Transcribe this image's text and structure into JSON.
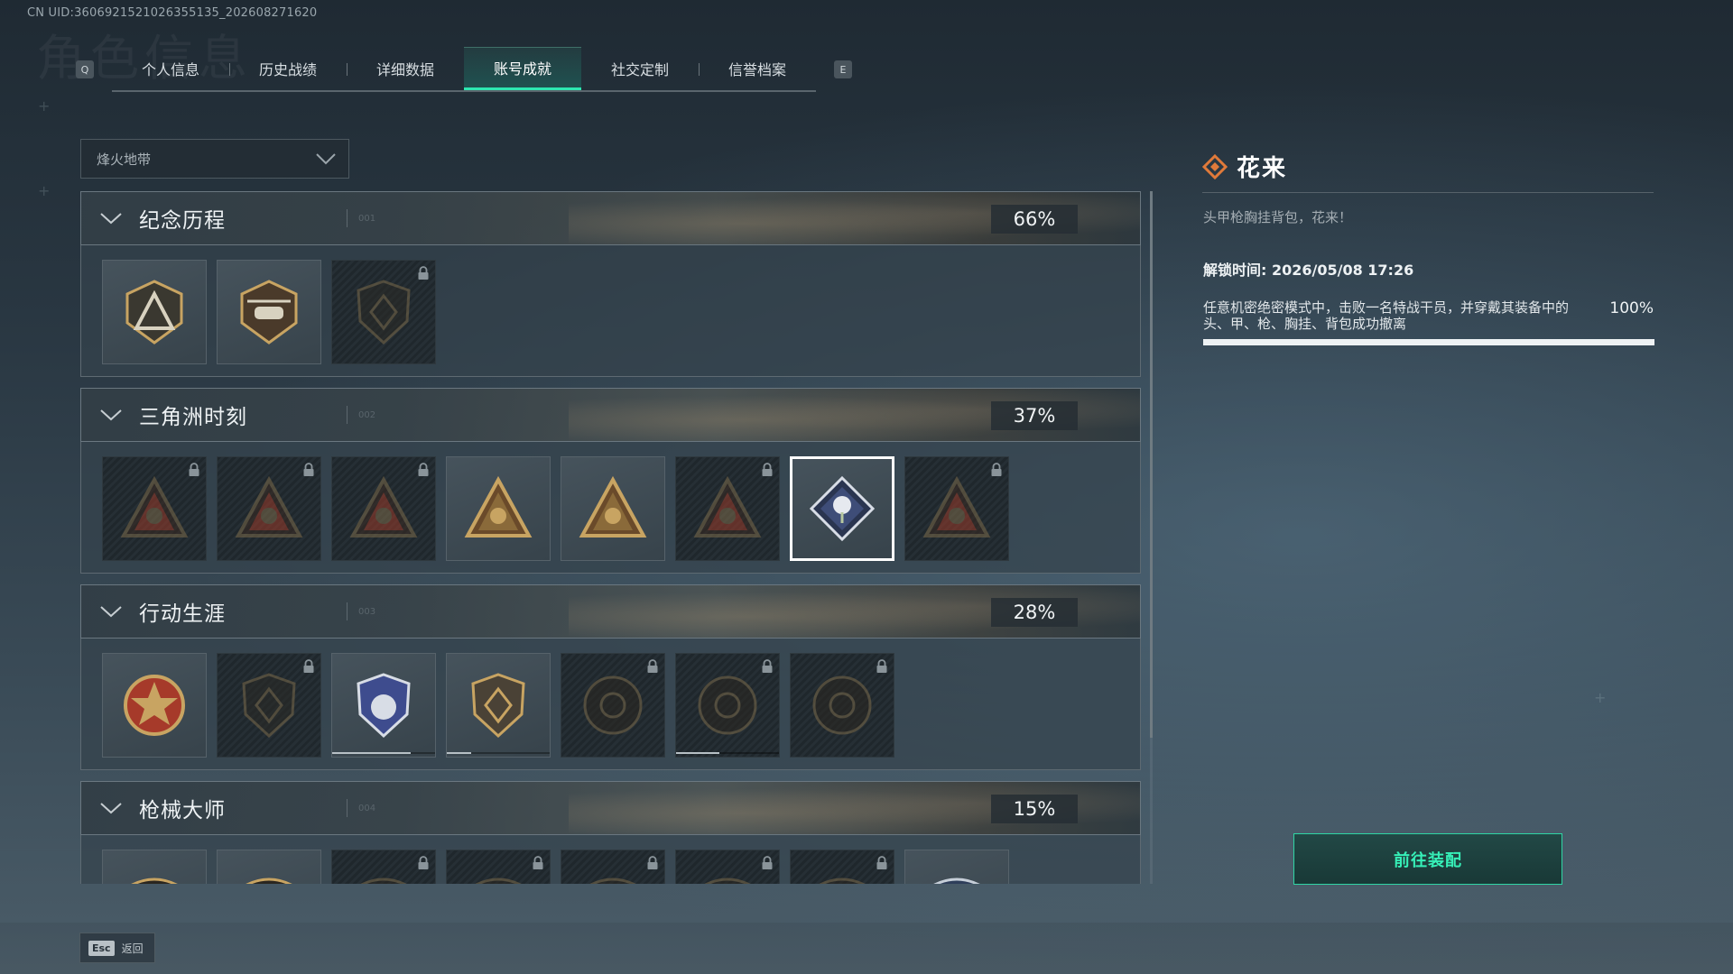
{
  "uid_text": "CN UID:3606921521026355135_202608271620",
  "ghost_title": "角色信息",
  "tabs": {
    "prev_key": "Q",
    "next_key": "E",
    "items": [
      {
        "label": "个人信息",
        "active": false
      },
      {
        "label": "历史战绩",
        "active": false
      },
      {
        "label": "详细数据",
        "active": false
      },
      {
        "label": "账号成就",
        "active": true
      },
      {
        "label": "社交定制",
        "active": false
      },
      {
        "label": "信誉档案",
        "active": false
      }
    ]
  },
  "mode_select": {
    "value": "烽火地带"
  },
  "sections": [
    {
      "title": "纪念历程",
      "num": "001",
      "percent": "66%",
      "badges": [
        {
          "icon": "delta-emblem-icon",
          "locked": false
        },
        {
          "icon": "helicopter-emblem-icon",
          "locked": false
        },
        {
          "icon": "diamond-shield-emblem-icon",
          "locked": true
        }
      ]
    },
    {
      "title": "三角洲时刻",
      "num": "002",
      "percent": "37%",
      "badges": [
        {
          "icon": "triangle-backpack-emblem-icon",
          "locked": true
        },
        {
          "icon": "triangle-soldier-emblem-icon",
          "locked": true
        },
        {
          "icon": "triangle-gem-emblem-icon",
          "locked": true
        },
        {
          "icon": "triangle-squad-emblem-icon",
          "locked": false
        },
        {
          "icon": "triangle-beast-emblem-icon",
          "locked": false
        },
        {
          "icon": "triangle-fish-emblem-icon",
          "locked": true
        },
        {
          "icon": "rose-diamond-emblem-icon",
          "locked": false,
          "selected": true
        },
        {
          "icon": "triangle-dragon-emblem-icon",
          "locked": true
        }
      ]
    },
    {
      "title": "行动生涯",
      "num": "003",
      "percent": "28%",
      "badges": [
        {
          "icon": "star-medal-emblem-icon",
          "locked": false
        },
        {
          "icon": "shield-crest-emblem-icon",
          "locked": true
        },
        {
          "icon": "police-badge-emblem-icon",
          "locked": false,
          "progress": 0.76
        },
        {
          "icon": "gem-shield-emblem-icon",
          "locked": false,
          "progress": 0.24
        },
        {
          "icon": "round-mask-emblem-icon",
          "locked": true
        },
        {
          "icon": "skull-target-emblem-icon",
          "locked": true,
          "progress": 0.42
        },
        {
          "icon": "eye-emblem-icon",
          "locked": true
        }
      ]
    },
    {
      "title": "枪械大师",
      "num": "004",
      "percent": "15%",
      "badges": [
        {
          "icon": "gun-crest-emblem-icon",
          "locked": false
        },
        {
          "icon": "gun-crest-emblem-icon",
          "locked": false
        },
        {
          "icon": "gun-crest-emblem-icon",
          "locked": true
        },
        {
          "icon": "gun-crest-emblem-icon",
          "locked": true
        },
        {
          "icon": "gun-crest-emblem-icon",
          "locked": true
        },
        {
          "icon": "gun-crest-emblem-icon",
          "locked": true
        },
        {
          "icon": "gun-crest-emblem-icon",
          "locked": true
        },
        {
          "icon": "blue-gun-crest-emblem-icon",
          "locked": false
        }
      ]
    }
  ],
  "detail": {
    "name": "花来",
    "description": "头甲枪胸挂背包，花来！",
    "unlock_time": "解锁时间: 2026/05/08 17:26",
    "task_line1": "任意机密绝密模式中，击败一名特战干员，并穿戴其装备中的",
    "task_line2": "头、甲、枪、胸挂、背包成功撤离",
    "task_percent": "100%",
    "task_progress": 1.0
  },
  "equip_button": "前往装配",
  "esc": {
    "key": "Esc",
    "label": "返回"
  },
  "colors": {
    "accent": "#2ee6b0",
    "gold": "#c8a462",
    "lock": "#8a949a"
  }
}
